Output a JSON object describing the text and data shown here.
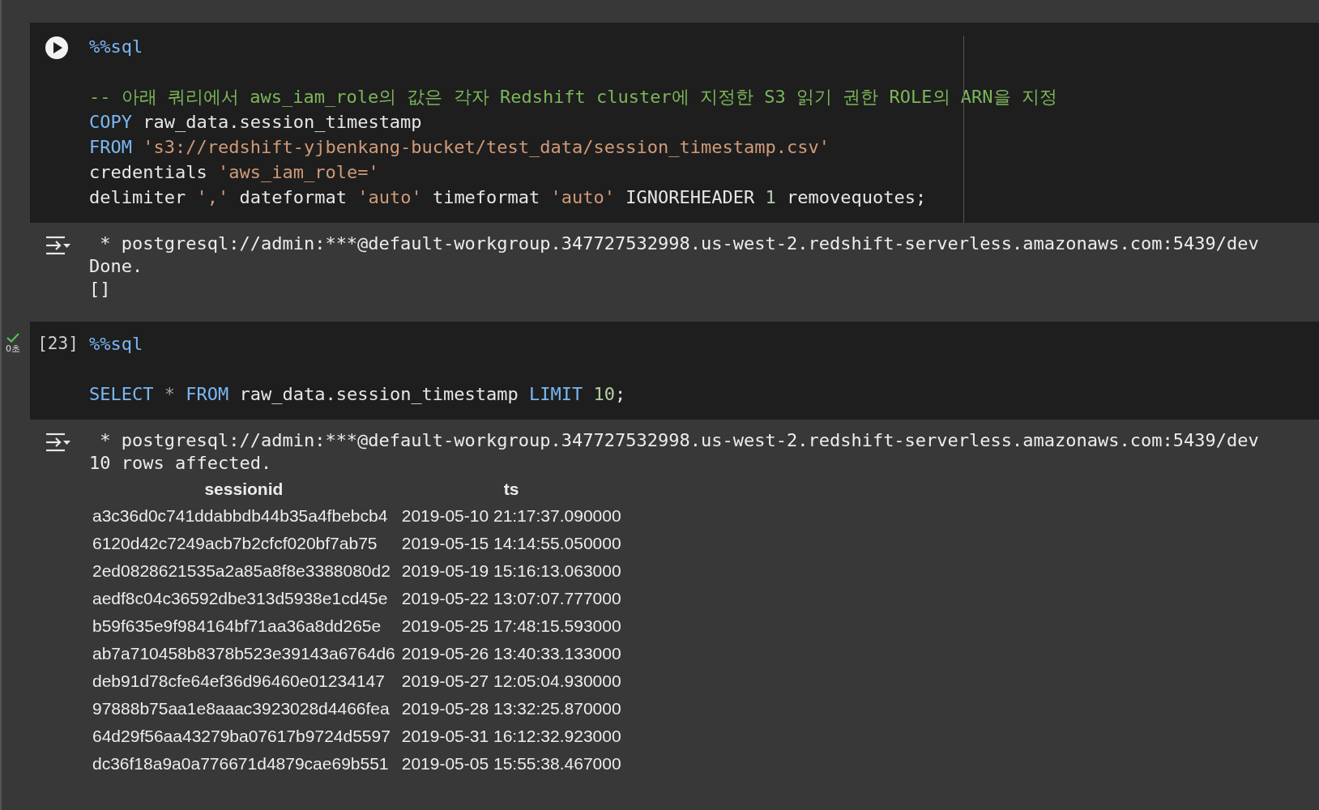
{
  "cells": [
    {
      "gutter": {
        "kind": "run-button"
      },
      "code": [
        {
          "tokens": [
            {
              "kind": "magic",
              "text": "%%sql"
            }
          ]
        },
        {
          "tokens": [
            {
              "kind": "comment",
              "text": "-- 아래 쿼리에서 aws_iam_role의 값은 각자 Redshift cluster에 지정한 S3 읽기 권한 ROLE의 ARN을 지정"
            }
          ]
        },
        {
          "tokens": [
            {
              "kind": "keyword",
              "text": "COPY "
            },
            {
              "kind": "plain",
              "text": "raw_data.session_timestamp"
            }
          ]
        },
        {
          "tokens": [
            {
              "kind": "keyword",
              "text": "FROM "
            },
            {
              "kind": "string",
              "text": "'s3://redshift-yjbenkang-bucket/test_data/session_timestamp.csv'"
            }
          ]
        },
        {
          "tokens": [
            {
              "kind": "plain",
              "text": "credentials "
            },
            {
              "kind": "string",
              "text": "'aws_iam_role='"
            }
          ]
        },
        {
          "tokens": [
            {
              "kind": "plain",
              "text": "delimiter "
            },
            {
              "kind": "string",
              "text": "','"
            },
            {
              "kind": "plain",
              "text": " dateformat "
            },
            {
              "kind": "string",
              "text": "'auto'"
            },
            {
              "kind": "plain",
              "text": " timeformat "
            },
            {
              "kind": "string",
              "text": "'auto'"
            },
            {
              "kind": "plain",
              "text": " IGNOREHEADER "
            },
            {
              "kind": "number",
              "text": "1"
            },
            {
              "kind": "plain",
              "text": " removequotes;"
            }
          ]
        }
      ],
      "output": {
        "connection": "* postgresql://admin:***@default-workgroup.347727532998.us-west-2.redshift-serverless.amazonaws.com:5439/dev",
        "lines": [
          "Done.",
          "[]"
        ]
      }
    },
    {
      "gutter": {
        "kind": "count",
        "count": "[23]",
        "time": "0초"
      },
      "code": [
        {
          "tokens": [
            {
              "kind": "magic",
              "text": "%%sql"
            }
          ]
        },
        {
          "tokens": [
            {
              "kind": "keyword",
              "text": "SELECT "
            },
            {
              "kind": "operator",
              "text": "* "
            },
            {
              "kind": "keyword",
              "text": "FROM "
            },
            {
              "kind": "plain",
              "text": "raw_data.session_timestamp "
            },
            {
              "kind": "keyword",
              "text": "LIMIT "
            },
            {
              "kind": "number",
              "text": "10"
            },
            {
              "kind": "plain",
              "text": ";"
            }
          ]
        }
      ],
      "output": {
        "connection": "* postgresql://admin:***@default-workgroup.347727532998.us-west-2.redshift-serverless.amazonaws.com:5439/dev",
        "lines": [
          "10 rows affected."
        ],
        "table": {
          "columns": [
            "sessionid",
            "ts"
          ],
          "rows": [
            [
              "a3c36d0c741ddabbdb44b35a4fbebcb4",
              "2019-05-10 21:17:37.090000"
            ],
            [
              "6120d42c7249acb7b2cfcf020bf7ab75",
              "2019-05-15 14:14:55.050000"
            ],
            [
              "2ed0828621535a2a85a8f8e3388080d2",
              "2019-05-19 15:16:13.063000"
            ],
            [
              "aedf8c04c36592dbe313d5938e1cd45e",
              "2019-05-22 13:07:07.777000"
            ],
            [
              "b59f635e9f984164bf71aa36a8dd265e",
              "2019-05-25 17:48:15.593000"
            ],
            [
              "ab7a710458b8378b523e39143a6764d6",
              "2019-05-26 13:40:33.133000"
            ],
            [
              "deb91d78cfe64ef36d96460e01234147",
              "2019-05-27 12:05:04.930000"
            ],
            [
              "97888b75aa1e8aaac3923028d4466fea",
              "2019-05-28 13:32:25.870000"
            ],
            [
              "64d29f56aa43279ba07617b9724d5597",
              "2019-05-31 16:12:32.923000"
            ],
            [
              "dc36f18a9a0a776671d4879cae69b551",
              "2019-05-05 15:55:38.467000"
            ]
          ]
        }
      }
    }
  ]
}
